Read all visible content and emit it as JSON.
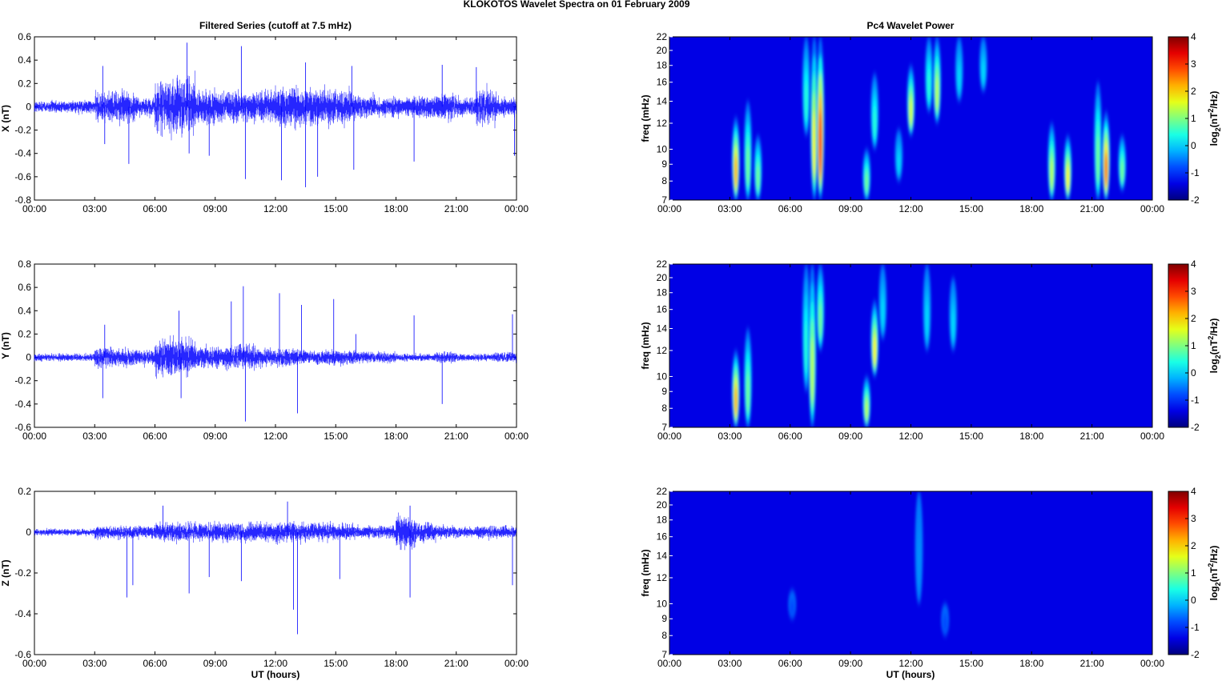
{
  "chart_data": {
    "title": "KLOKOTOS Wavelet Spectra on 01 February  2009",
    "left_title": "Filtered Series (cutoff at 7.5 mHz)",
    "right_title": "Pc4 Wavelet Power",
    "xlabel": "UT (hours)",
    "xticks": [
      "00:00",
      "03:00",
      "06:00",
      "09:00",
      "12:00",
      "15:00",
      "18:00",
      "21:00",
      "00:00"
    ],
    "series_color": "#0000ff",
    "series": [
      {
        "type": "line",
        "ylabel": "X (nT)",
        "ylim": [
          -0.8,
          0.6
        ],
        "yticks": [
          -0.8,
          -0.6,
          -0.4,
          -0.2,
          0,
          0.2,
          0.4,
          0.6
        ],
        "envelope_by_hour": [
          0.03,
          0.03,
          0.035,
          0.08,
          0.08,
          0.05,
          0.14,
          0.16,
          0.09,
          0.08,
          0.08,
          0.08,
          0.11,
          0.1,
          0.1,
          0.09,
          0.06,
          0.05,
          0.05,
          0.06,
          0.08,
          0.05,
          0.1,
          0.05
        ],
        "spikes": [
          [
            3.4,
            0.35
          ],
          [
            3.5,
            -0.32
          ],
          [
            4.7,
            -0.49
          ],
          [
            7.6,
            0.55
          ],
          [
            7.7,
            -0.4
          ],
          [
            8.7,
            -0.42
          ],
          [
            10.3,
            0.52
          ],
          [
            10.5,
            -0.62
          ],
          [
            12.3,
            -0.63
          ],
          [
            13.5,
            -0.69
          ],
          [
            13.5,
            0.38
          ],
          [
            14.1,
            -0.6
          ],
          [
            15.8,
            0.35
          ],
          [
            15.9,
            -0.54
          ],
          [
            18.9,
            -0.47
          ],
          [
            20.3,
            0.36
          ],
          [
            22,
            0.34
          ],
          [
            23.9,
            -0.42
          ]
        ]
      },
      {
        "type": "line",
        "ylabel": "Y (nT)",
        "ylim": [
          -0.6,
          0.8
        ],
        "yticks": [
          -0.6,
          -0.4,
          -0.2,
          0,
          0.2,
          0.4,
          0.6,
          0.8
        ],
        "envelope_by_hour": [
          0.02,
          0.02,
          0.02,
          0.06,
          0.05,
          0.04,
          0.1,
          0.1,
          0.06,
          0.06,
          0.07,
          0.05,
          0.05,
          0.04,
          0.04,
          0.04,
          0.03,
          0.03,
          0.02,
          0.02,
          0.03,
          0.02,
          0.02,
          0.03
        ],
        "spikes": [
          [
            3.5,
            0.28
          ],
          [
            3.4,
            -0.35
          ],
          [
            7.2,
            0.4
          ],
          [
            7.3,
            -0.35
          ],
          [
            9.8,
            0.48
          ],
          [
            10.4,
            0.61
          ],
          [
            10.5,
            -0.55
          ],
          [
            12.2,
            0.55
          ],
          [
            13.1,
            -0.48
          ],
          [
            13.3,
            0.45
          ],
          [
            14.9,
            0.5
          ],
          [
            16,
            0.2
          ],
          [
            18.9,
            0.36
          ],
          [
            20.3,
            -0.4
          ],
          [
            23.8,
            0.37
          ]
        ]
      },
      {
        "type": "line",
        "ylabel": "Z (nT)",
        "ylim": [
          -0.6,
          0.2
        ],
        "yticks": [
          -0.6,
          -0.4,
          -0.2,
          0,
          0.2
        ],
        "envelope_by_hour": [
          0.01,
          0.01,
          0.01,
          0.02,
          0.02,
          0.02,
          0.03,
          0.03,
          0.03,
          0.03,
          0.03,
          0.03,
          0.035,
          0.03,
          0.03,
          0.025,
          0.02,
          0.02,
          0.05,
          0.03,
          0.02,
          0.015,
          0.02,
          0.02
        ],
        "spikes": [
          [
            4.6,
            -0.32
          ],
          [
            4.9,
            -0.26
          ],
          [
            6.4,
            0.13
          ],
          [
            7.7,
            -0.3
          ],
          [
            8.7,
            -0.22
          ],
          [
            10.3,
            -0.24
          ],
          [
            12.6,
            0.15
          ],
          [
            13.1,
            -0.5
          ],
          [
            12.9,
            -0.38
          ],
          [
            15.2,
            -0.23
          ],
          [
            18.7,
            0.13
          ],
          [
            18.7,
            -0.32
          ],
          [
            23.8,
            -0.26
          ]
        ]
      }
    ],
    "spectra": {
      "type": "heatmap",
      "ylabel": "freq (mHz)",
      "yscale": "log",
      "ylim": [
        7,
        22
      ],
      "yticks": [
        7,
        8,
        9,
        10,
        12,
        14,
        16,
        18,
        20,
        22
      ],
      "colorbar_label": "log2(nT2/Hz)",
      "clim": [
        -2,
        4
      ],
      "cticks": [
        -2,
        -1,
        0,
        1,
        2,
        3,
        4
      ],
      "panels": [
        {
          "blobs": [
            [
              3.3,
              7,
              12.5,
              2
            ],
            [
              3.9,
              7,
              14,
              0.5
            ],
            [
              4.4,
              7,
              11,
              0.5
            ],
            [
              6.8,
              11,
              22,
              0
            ],
            [
              7.2,
              7,
              22,
              1.5
            ],
            [
              7.5,
              7,
              22,
              3
            ],
            [
              9.8,
              7,
              10,
              0.5
            ],
            [
              10.2,
              10,
              17,
              0
            ],
            [
              11.4,
              8,
              11.5,
              -0.5
            ],
            [
              12.0,
              11,
              18,
              1.2
            ],
            [
              12.9,
              13,
              22,
              0
            ],
            [
              13.3,
              12,
              22,
              1
            ],
            [
              14.4,
              14,
              22,
              -0.5
            ],
            [
              15.6,
              15,
              22,
              -0.5
            ],
            [
              19.0,
              7,
              12,
              1
            ],
            [
              19.8,
              7,
              11,
              1.5
            ],
            [
              21.3,
              7,
              16,
              0.5
            ],
            [
              21.7,
              7,
              13,
              2.5
            ],
            [
              22.5,
              7.5,
              11,
              0.5
            ]
          ]
        },
        {
          "blobs": [
            [
              3.3,
              7,
              12,
              2
            ],
            [
              3.9,
              7,
              14,
              0.5
            ],
            [
              6.8,
              9,
              22,
              0
            ],
            [
              7.1,
              7,
              22,
              1
            ],
            [
              7.5,
              12,
              22,
              0.5
            ],
            [
              9.8,
              7,
              10,
              1
            ],
            [
              10.2,
              10,
              17,
              1.5
            ],
            [
              10.6,
              13,
              22,
              -0.5
            ],
            [
              12.8,
              12,
              22,
              -0.5
            ],
            [
              14.1,
              12,
              20,
              -0.5
            ]
          ]
        },
        {
          "blobs": [
            [
              12.4,
              10,
              22,
              -1
            ],
            [
              6.1,
              9,
              11,
              -1.5
            ],
            [
              13.7,
              8,
              10,
              -1.5
            ]
          ]
        }
      ]
    }
  }
}
